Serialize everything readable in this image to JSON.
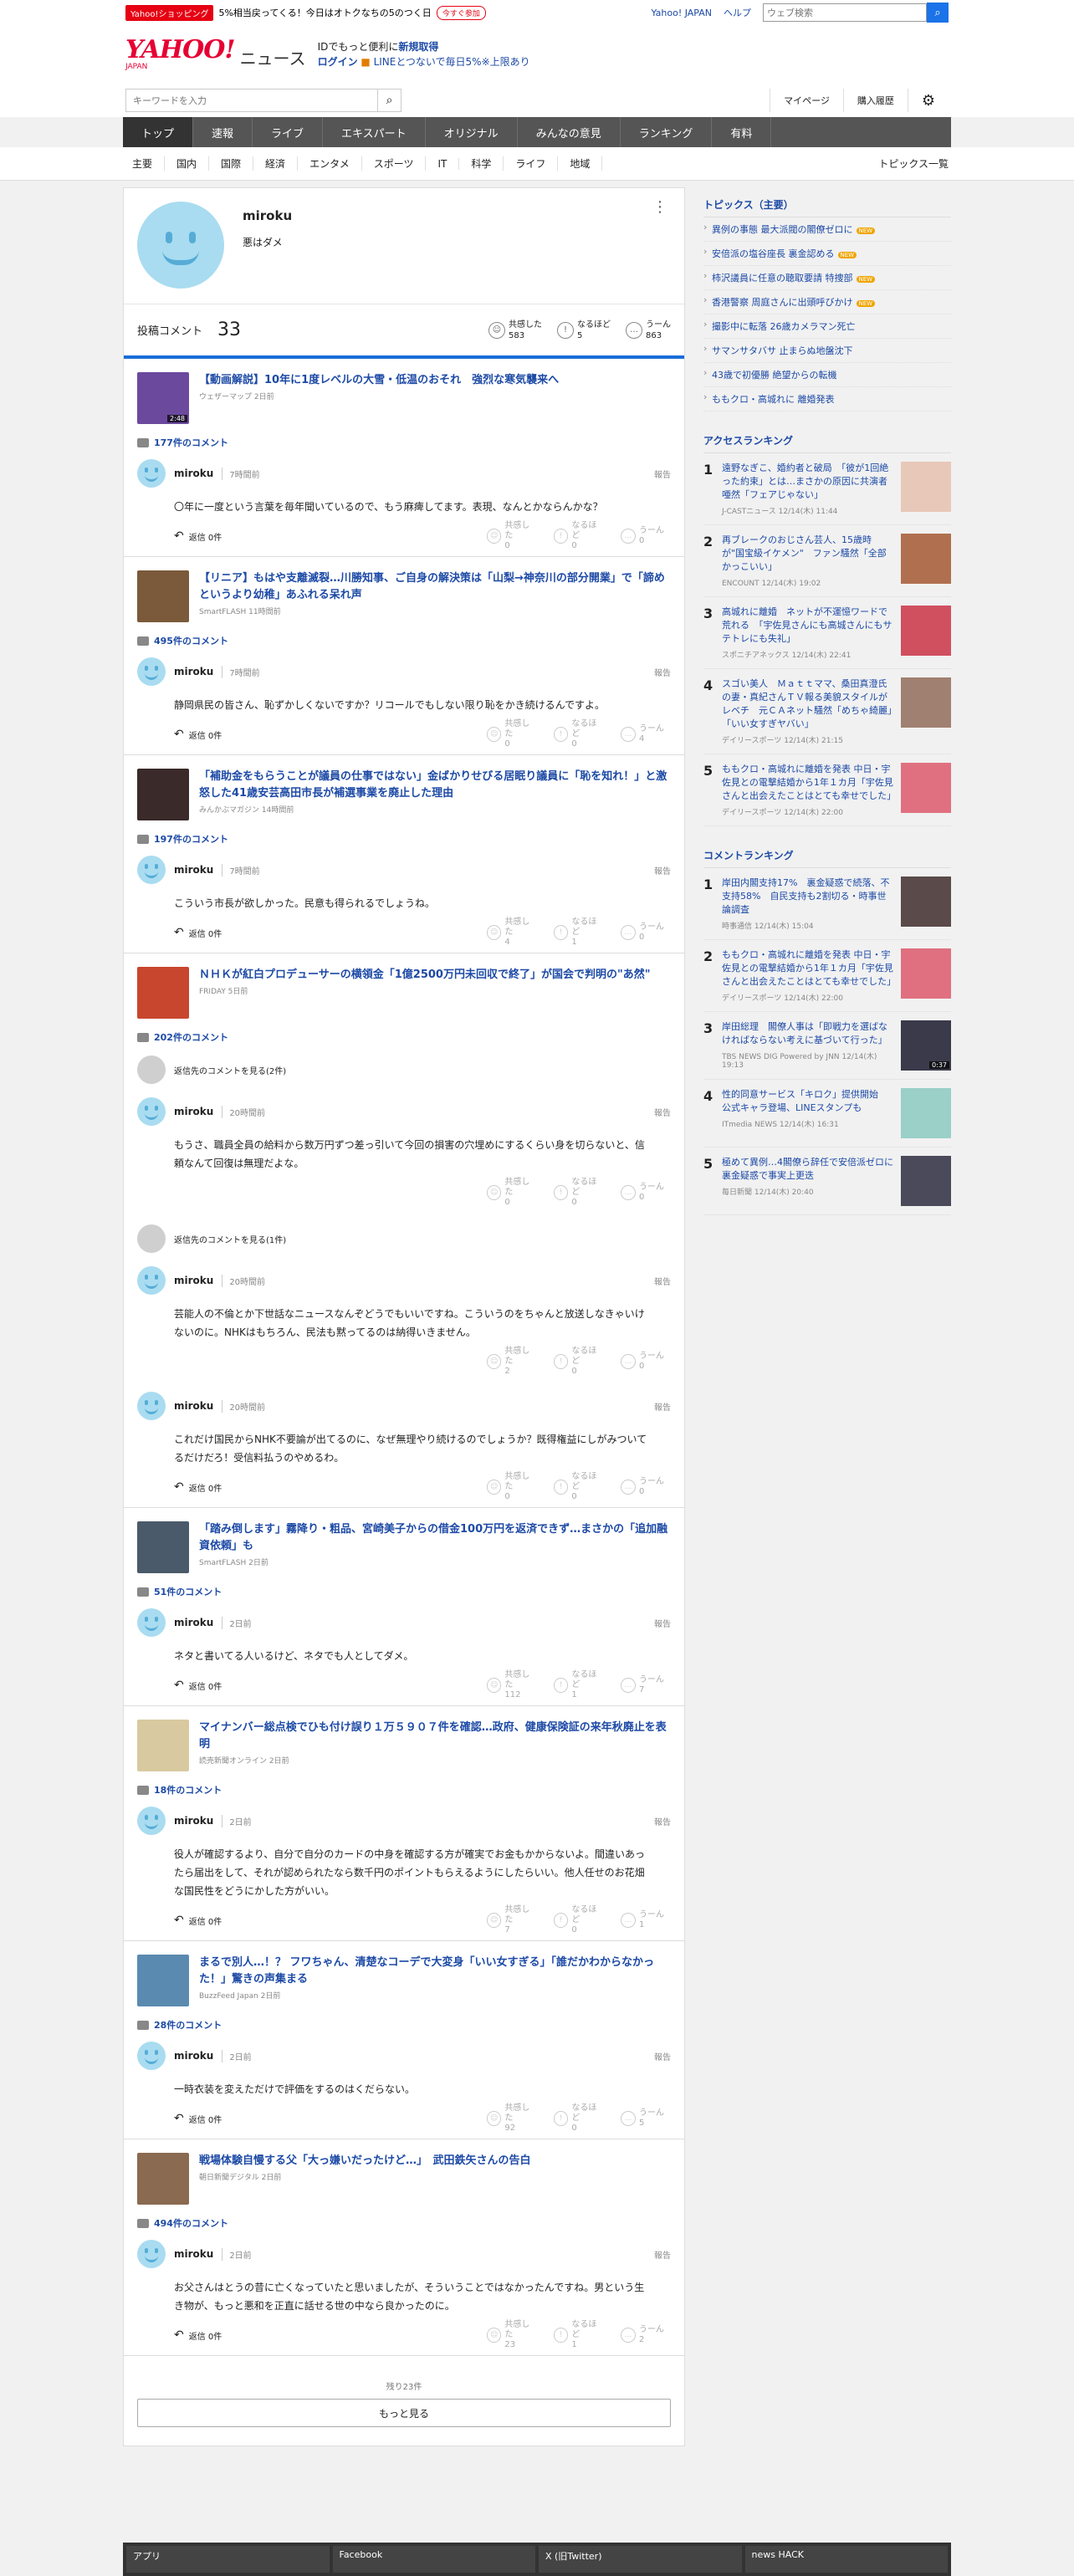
{
  "promo": {
    "tag": "Yahoo!ショッピング",
    "text": "5%相当戻ってくる！今日はオトクなちの5のつく日",
    "button": "今すぐ参加",
    "links": [
      "Yahoo! JAPAN",
      "ヘルプ"
    ],
    "search_placeholder": "ウェブ検索"
  },
  "header": {
    "logo": "YAHOO!",
    "logo_sub": "JAPAN",
    "service": "ニュース",
    "line1_pre": "IDでもっと便利に",
    "line1_link": "新規取得",
    "line2_login": "ログイン",
    "line2_text": "LINEとつないで毎日5%",
    "line2_note": "※上限あり"
  },
  "search": {
    "placeholder": "キーワードを入力",
    "tools": [
      "マイページ",
      "購入履歴"
    ]
  },
  "nav": [
    "トップ",
    "速報",
    "ライブ",
    "エキスパート",
    "オリジナル",
    "みんなの意見",
    "ランキング",
    "有料"
  ],
  "categories": [
    "主要",
    "国内",
    "国際",
    "経済",
    "エンタメ",
    "スポーツ",
    "IT",
    "科学",
    "ライフ",
    "地域"
  ],
  "categories_all": "トピックス一覧",
  "profile": {
    "name": "miroku",
    "bio": "悪はダメ",
    "posted_label": "投稿コメント",
    "posted_count": "33",
    "reactions": [
      {
        "label": "共感した",
        "value": "583",
        "icon": "☺"
      },
      {
        "label": "なるほど",
        "value": "5",
        "icon": "!"
      },
      {
        "label": "うーん",
        "value": "863",
        "icon": "…"
      }
    ]
  },
  "labels": {
    "reply": "返信 0件",
    "report": "報告",
    "empathy": "共感した",
    "naruhodo": "なるほど",
    "uun": "うーん"
  },
  "articles": [
    {
      "title": "【動画解説】10年に1度レベルの大雪・低温のおそれ　強烈な寒気襲来へ",
      "meta": "ウェザーマップ 2日前",
      "count": "177件のコメント",
      "thumb": "#6b4a9e",
      "dur": "2:48",
      "comments": [
        {
          "time": "7時間前",
          "text": "〇年に一度という言葉を毎年聞いているので、もう麻痺してます。表現、なんとかならんかな？",
          "r": [
            "0",
            "0",
            "0"
          ]
        }
      ]
    },
    {
      "title": "【リニア】もはや支離滅裂…川勝知事、ご自身の解決策は「山梨→神奈川の部分開業」で「諦めというより幼稚」あふれる呆れ声",
      "meta": "SmartFLASH 11時間前",
      "count": "495件のコメント",
      "thumb": "#7a5a3a",
      "comments": [
        {
          "time": "7時間前",
          "text": "静岡県民の皆さん、恥ずかしくないですか？リコールでもしない限り恥をかき続けるんですよ。",
          "r": [
            "0",
            "0",
            "4"
          ]
        }
      ]
    },
    {
      "title": "「補助金をもらうことが議員の仕事ではない」金ばかりせびる居眠り議員に「恥を知れ！」と激怒した41歳安芸高田市長が補選事業を廃止した理由",
      "meta": "みんかぶマガジン 14時間前",
      "count": "197件のコメント",
      "thumb": "#3a2a2a",
      "comments": [
        {
          "time": "7時間前",
          "text": "こういう市長が欲しかった。民意も得られるでしょうね。",
          "r": [
            "4",
            "1",
            "0"
          ]
        }
      ]
    },
    {
      "title": "ＮＨＫが紅白プロデューサーの横領金「1億2500万円未回収で終了」が国会で判明の\"あ然\"",
      "meta": "FRIDAY 5日前",
      "count": "202件のコメント",
      "thumb": "#c8462e",
      "comments": [
        {
          "parent": "返信先のコメントを見る(2件)",
          "time": "20時間前",
          "text": "もうさ、職員全員の給料から数万円ずつ差っ引いて今回の損害の穴埋めにするくらい身を切らないと、信頼なんて回復は無理だよな。",
          "r": [
            "0",
            "0",
            "0"
          ],
          "noreply": true
        },
        {
          "parent": "返信先のコメントを見る(1件)",
          "time": "20時間前",
          "text": "芸能人の不倫とか下世話なニュースなんぞどうでもいいですね。こういうのをちゃんと放送しなきゃいけないのに。NHKはもちろん、民法も黙ってるのは納得いきません。",
          "r": [
            "2",
            "0",
            "0"
          ],
          "noreply": true
        },
        {
          "time": "20時間前",
          "text": "これだけ国民からNHK不要論が出てるのに、なぜ無理やり続けるのでしょうか？既得権益にしがみついてるだけだろ！受信料払うのやめるわ。",
          "r": [
            "0",
            "0",
            "0"
          ]
        }
      ]
    },
    {
      "title": "「踏み倒します」霧降り・粗品、宮崎美子からの借金100万円を返済できず…まさかの「追加融資依頼」も",
      "meta": "SmartFLASH 2日前",
      "count": "51件のコメント",
      "thumb": "#4a5a6a",
      "comments": [
        {
          "time": "2日前",
          "text": "ネタと書いてる人いるけど、ネタでも人としてダメ。",
          "r": [
            "112",
            "1",
            "7"
          ]
        }
      ]
    },
    {
      "title": "マイナンバー総点検でひも付け誤り１万５９０７件を確認…政府、健康保険証の来年秋廃止を表明",
      "meta": "読売新聞オンライン 2日前",
      "count": "18件のコメント",
      "thumb": "#d9c9a0",
      "comments": [
        {
          "time": "2日前",
          "text": "役人が確認するより、自分で自分のカードの中身を確認する方が確実でお金もかからないよ。間違いあったら届出をして、それが認められたなら数千円のポイントもらえるようにしたらいい。他人任せのお花畑な国民性をどうにかした方がいい。",
          "r": [
            "7",
            "0",
            "1"
          ]
        }
      ]
    },
    {
      "title": "まるで別人…！？ フワちゃん、清楚なコーデで大変身「いい女すぎる」「誰だかわからなかった！」驚きの声集まる",
      "meta": "BuzzFeed Japan 2日前",
      "count": "28件のコメント",
      "thumb": "#5a8ab0",
      "comments": [
        {
          "time": "2日前",
          "text": "一時衣装を変えただけで評価をするのはくだらない。",
          "r": [
            "92",
            "0",
            "5"
          ]
        }
      ]
    },
    {
      "title": "戦場体験自慢する父「大っ嫌いだったけど…」　武田鉄矢さんの告白",
      "meta": "朝日新聞デジタル 2日前",
      "count": "494件のコメント",
      "thumb": "#8a6a50",
      "comments": [
        {
          "time": "2日前",
          "text": "お父さんはとうの昔に亡くなっていたと思いましたが、そういうことではなかったんですね。男という生き物が、もっと悪和を正直に話せる世の中なら良かったのに。",
          "r": [
            "23",
            "1",
            "2"
          ]
        }
      ]
    }
  ],
  "more": {
    "remain": "残り23件",
    "button": "もっと見る"
  },
  "topics": {
    "title": "トピックス（主要）",
    "items": [
      {
        "t": "異例の事態 最大派閥の閣僚ゼロに",
        "new": true
      },
      {
        "t": "安倍派の塩谷座長 裏金認める",
        "new": true
      },
      {
        "t": "柿沢議員に任意の聴取要請 特捜部",
        "new": true
      },
      {
        "t": "香港警察 周庭さんに出頭呼びかけ",
        "new": true
      },
      {
        "t": "撮影中に転落 26歳カメラマン死亡",
        "new": false
      },
      {
        "t": "サマンサタバサ 止まらぬ地盤沈下",
        "new": false
      },
      {
        "t": "43歳で初優勝 絶望からの転機",
        "new": false
      },
      {
        "t": "ももクロ・高城れに 離婚発表",
        "new": false
      }
    ],
    "new_label": "NEW"
  },
  "access": {
    "title": "アクセスランキング",
    "items": [
      {
        "n": "1",
        "t": "遠野なぎこ、婚約者と破局　「彼が1回絶った約束」とは…まさかの原因に共演者唖然「フェアじゃない」",
        "m": "J-CASTニュース 12/14(木) 11:44",
        "c": "#e8c8b8"
      },
      {
        "n": "2",
        "t": "再ブレークのおじさん芸人、15歳時が\"国宝級イケメン\"　ファン騒然「全部かっこいい」",
        "m": "ENCOUNT 12/14(木) 19:02",
        "c": "#b07050"
      },
      {
        "n": "3",
        "t": "高城れに離婚　ネットが不運憶ワードで荒れる　「宇佐見さんにも高城さんにもサテトレにも失礼」",
        "m": "スポニチアネックス 12/14(木) 22:41",
        "c": "#d05060"
      },
      {
        "n": "4",
        "t": "スゴい美人　Ｍａｔｔママ、桑田真澄氏の妻・真紀さんＴＶ報る美貌スタイルがレベチ　元ＣＡネット騒然「めちゃ綺麗」「いい女すぎヤバい」",
        "m": "デイリースポーツ 12/14(木) 21:15",
        "c": "#a08070"
      },
      {
        "n": "5",
        "t": "ももクロ・高城れに離婚を発表 中日・宇佐見との電撃結婚から1年１カ月「宇佐見さんと出会えたことはとても幸せでした」",
        "m": "デイリースポーツ 12/14(木) 22:00",
        "c": "#e07080"
      }
    ]
  },
  "commentrank": {
    "title": "コメントランキング",
    "items": [
      {
        "n": "1",
        "t": "岸田内閣支持17%　裏金疑惑で続落、不支持58%　自民支持も2割切る・時事世論調査",
        "m": "時事通信 12/14(木) 15:04",
        "c": "#5a4a4a"
      },
      {
        "n": "2",
        "t": "ももクロ・高城れに離婚を発表 中日・宇佐見との電撃結婚から1年１カ月「宇佐見さんと出会えたことはとても幸せでした」",
        "m": "デイリースポーツ 12/14(木) 22:00",
        "c": "#e07080"
      },
      {
        "n": "3",
        "t": "岸田総理　閣僚人事は「即戦力を選ばなければならない考えに基づいて行った」",
        "m": "TBS NEWS DIG Powered by JNN 12/14(木) 19:13",
        "c": "#3a3a4a",
        "dur": "0:37"
      },
      {
        "n": "4",
        "t": "性的同意サービス「キロク」提供開始　公式キャラ登場、LINEスタンプも",
        "m": "ITmedia NEWS 12/14(木) 16:31",
        "c": "#9ad0c8"
      },
      {
        "n": "5",
        "t": "極めて異例…4閣僚ら辞任で安倍派ゼロに　裏金疑惑で事実上更迭",
        "m": "毎日新聞 12/14(木) 20:40",
        "c": "#4a4a5a"
      }
    ]
  },
  "footer": [
    "アプリ",
    "Facebook",
    "X (旧Twitter)",
    "news HACK"
  ],
  "colors": {
    "accent": "#1d4aa6",
    "brand": "#e60033",
    "nav": "#555555"
  }
}
